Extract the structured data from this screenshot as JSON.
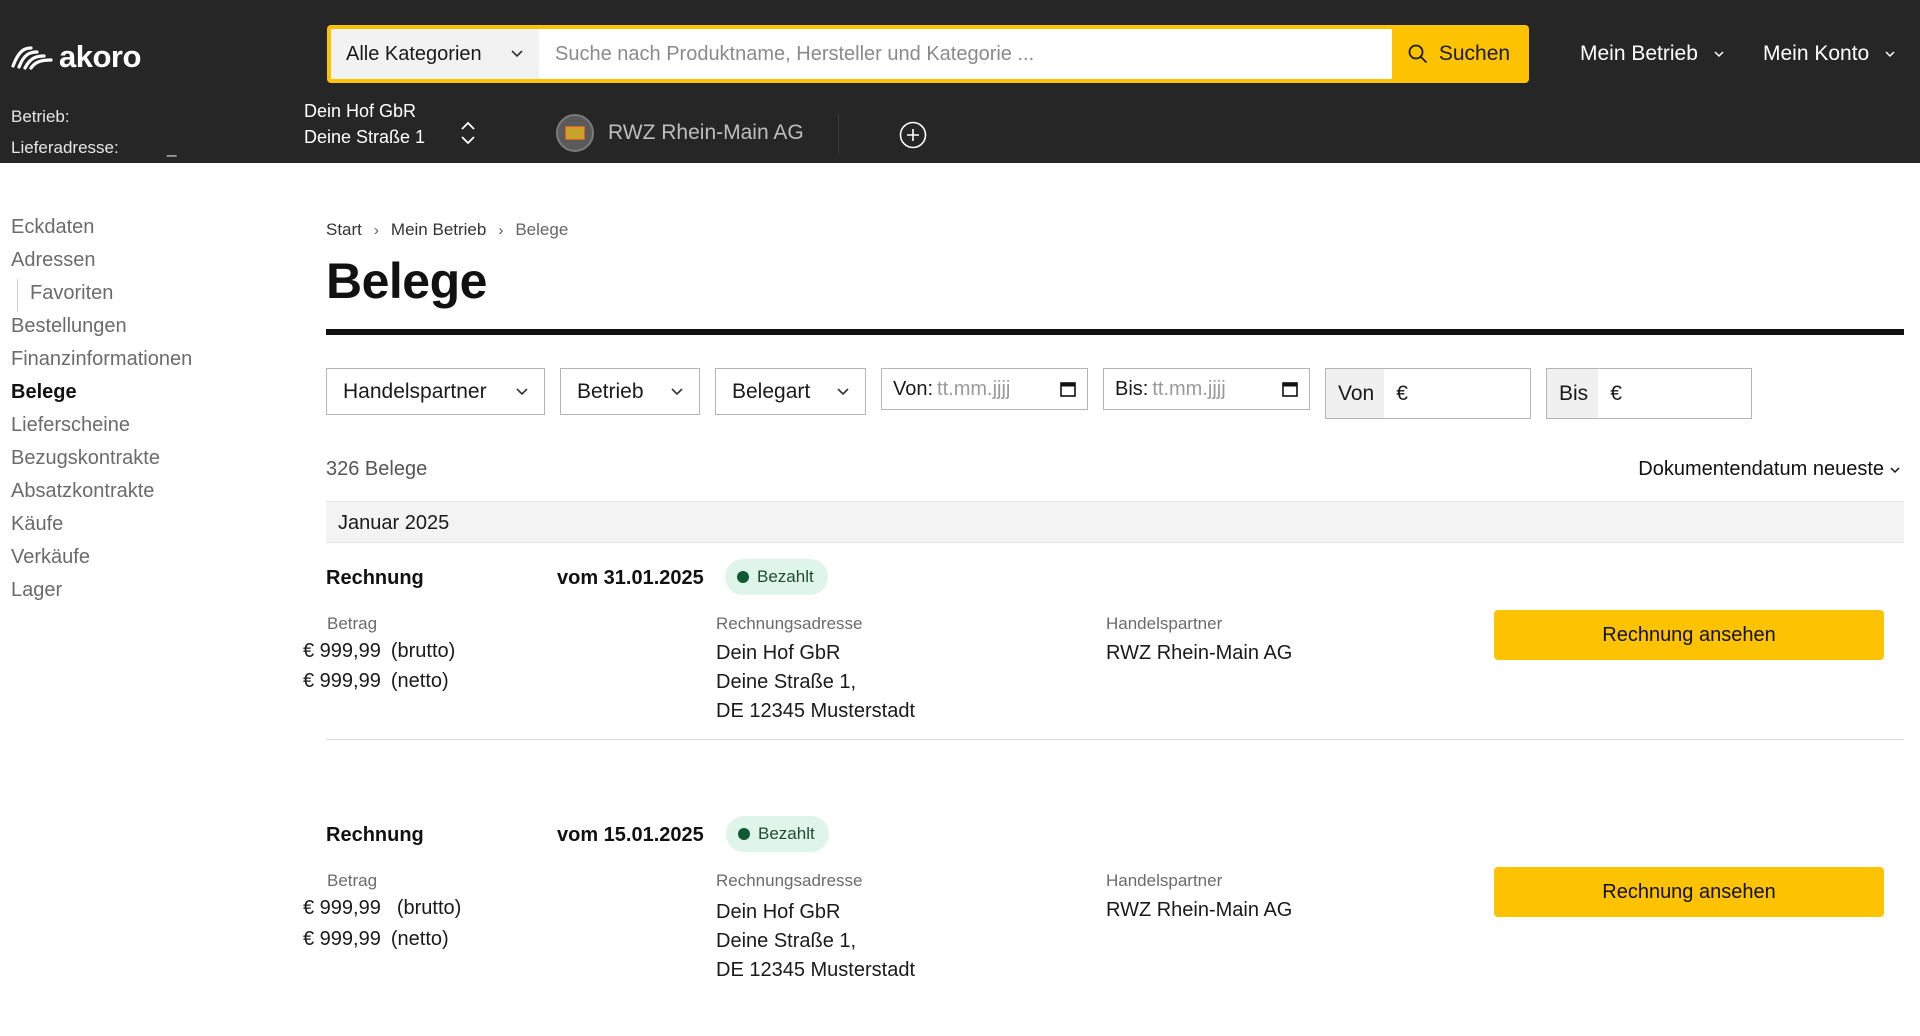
{
  "header": {
    "logo_text": "akoro",
    "search": {
      "category": "Alle Kategorien",
      "placeholder": "Suche nach Produktname, Hersteller und Kategorie ...",
      "button": "Suchen"
    },
    "menu_betrieb": "Mein Betrieb",
    "menu_konto": "Mein Konto",
    "context": {
      "betrieb_label": "Betrieb:",
      "lieferadresse_label": "Lieferadresse:",
      "lieferadresse_value": "_",
      "betrieb_name": "Dein Hof GbR",
      "betrieb_street": "Deine Straße 1"
    },
    "partner_name": "RWZ Rhein-Main AG"
  },
  "sidebar": {
    "items": [
      {
        "label": "Eckdaten"
      },
      {
        "label": "Adressen"
      },
      {
        "label": "Favoriten"
      },
      {
        "label": "Bestellungen"
      },
      {
        "label": "Finanzinformationen"
      },
      {
        "label": "Belege"
      },
      {
        "label": "Lieferscheine"
      },
      {
        "label": "Bezugskontrakte"
      },
      {
        "label": "Absatzkontrakte"
      },
      {
        "label": "Käufe"
      },
      {
        "label": "Verkäufe"
      },
      {
        "label": "Lager"
      }
    ]
  },
  "breadcrumb": {
    "start": "Start",
    "betrieb": "Mein Betrieb",
    "current": "Belege",
    "sep": "›"
  },
  "page_title": "Belege",
  "filters": {
    "handelspartner": "Handelspartner",
    "betrieb": "Betrieb",
    "belegart": "Belegart",
    "von_label": "Von:",
    "von_placeholder": "tt.mm.jjjj",
    "bis_label": "Bis:",
    "bis_placeholder": "tt.mm.jjjj",
    "betrag_von": "Von",
    "betrag_bis": "Bis",
    "currency": "€"
  },
  "results": {
    "count": "326 Belege",
    "sort": "Dokumentendatum neueste"
  },
  "month": "Januar 2025",
  "documents": [
    {
      "type": "Rechnung",
      "date": "vom 31.01.2025",
      "status": "Bezahlt",
      "amount_label": "Betrag",
      "brutto_value": "€ 999,99",
      "brutto_tag": "(brutto)",
      "netto_value": "€ 999,99",
      "netto_tag": "(netto)",
      "address_label": "Rechnungsadresse",
      "address_line1": "Dein Hof GbR",
      "address_line2": "Deine Straße 1,",
      "address_line3": "DE 12345 Musterstadt",
      "partner_label": "Handelspartner",
      "partner": "RWZ Rhein-Main AG",
      "button": "Rechnung ansehen"
    },
    {
      "type": "Rechnung",
      "date": "vom 15.01.2025",
      "status": "Bezahlt",
      "amount_label": "Betrag",
      "brutto_value": "€ 999,99",
      "brutto_tag": "(brutto)",
      "netto_value": "€ 999,99",
      "netto_tag": "(netto)",
      "address_label": "Rechnungsadresse",
      "address_line1": "Dein Hof GbR",
      "address_line2": "Deine Straße 1,",
      "address_line3": "DE 12345 Musterstadt",
      "partner_label": "Handelspartner",
      "partner": "RWZ Rhein-Main AG",
      "button": "Rechnung ansehen"
    }
  ],
  "colors": {
    "header_bg": "#262626",
    "accent": "#fdc300",
    "badge_bg": "#dff5ea",
    "badge_dot": "#0f5a35"
  }
}
